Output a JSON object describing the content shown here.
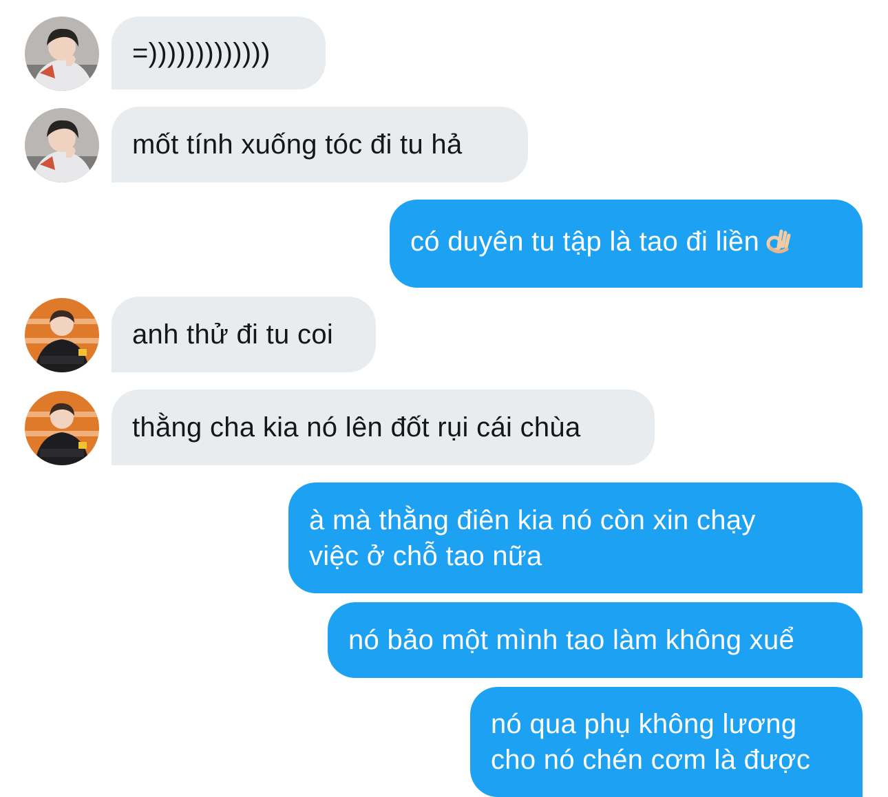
{
  "conversation": {
    "messages": [
      {
        "sender": "other",
        "avatar": "avatar-1",
        "lines": [
          "=)))))))))))))"
        ]
      },
      {
        "sender": "other",
        "avatar": "avatar-1",
        "lines": [
          "mốt tính xuống tóc đi tu hả"
        ]
      },
      {
        "sender": "me",
        "lines": [
          "có duyên tu tập là tao đi liền"
        ],
        "emoji": "ok-hand-emoji"
      },
      {
        "sender": "other",
        "avatar": "avatar-2",
        "lines": [
          "anh thử đi tu coi"
        ]
      },
      {
        "sender": "other",
        "avatar": "avatar-2",
        "lines": [
          "thằng cha kia nó lên đốt rụi cái chùa"
        ]
      },
      {
        "sender": "me",
        "lines": [
          "à mà thằng điên kia nó còn xin chạy",
          "việc ở chỗ tao nữa"
        ]
      },
      {
        "sender": "me",
        "lines": [
          "nó bảo một mình tao làm không xuể"
        ]
      },
      {
        "sender": "me",
        "lines": [
          "nó qua phụ không lương",
          "cho nó chén cơm là được"
        ]
      }
    ]
  },
  "colors": {
    "outgoing_bubble": "#1da1f2",
    "incoming_bubble": "#e9ecef",
    "incoming_text": "#14171a",
    "outgoing_text": "#ffffff"
  }
}
